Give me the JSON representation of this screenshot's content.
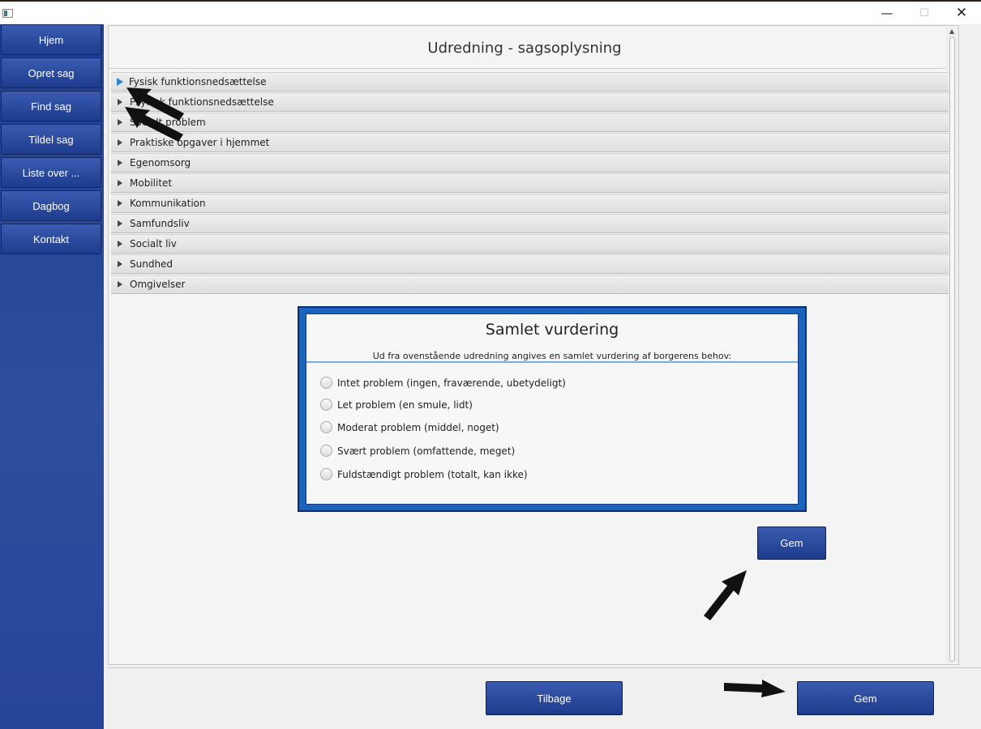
{
  "window": {
    "minimize": "—",
    "maximize": "☐",
    "close": "✕"
  },
  "sidebar": {
    "items": [
      {
        "label": "Hjem"
      },
      {
        "label": "Opret sag"
      },
      {
        "label": "Find sag"
      },
      {
        "label": "Tildel sag"
      },
      {
        "label": "Liste over ..."
      },
      {
        "label": "Dagbog"
      },
      {
        "label": "Kontakt"
      }
    ]
  },
  "main": {
    "title": "Udredning - sagsoplysning",
    "sections": [
      {
        "label": "Fysisk funktionsnedsættelse"
      },
      {
        "label": "Psykisk funktionsnedsættelse"
      },
      {
        "label": "Socialt problem"
      },
      {
        "label": "Praktiske opgaver i hjemmet"
      },
      {
        "label": "Egenomsorg"
      },
      {
        "label": "Mobilitet"
      },
      {
        "label": "Kommunikation"
      },
      {
        "label": "Samfundsliv"
      },
      {
        "label": "Socialt liv"
      },
      {
        "label": "Sundhed"
      },
      {
        "label": "Omgivelser"
      }
    ],
    "assessment": {
      "title": "Samlet vurdering",
      "subtitle": "Ud fra ovenstående udredning angives en samlet vurdering af borgerens behov:",
      "options": [
        {
          "label": "Intet problem (ingen, fraværende, ubetydeligt)"
        },
        {
          "label": "Let problem (en smule, lidt)"
        },
        {
          "label": "Moderat problem (middel, noget)"
        },
        {
          "label": "Svært problem (omfattende, meget)"
        },
        {
          "label": "Fuldstændigt problem (totalt, kan ikke)"
        }
      ],
      "save_label": "Gem"
    }
  },
  "footer": {
    "back_label": "Tilbage",
    "save_label": "Gem"
  }
}
